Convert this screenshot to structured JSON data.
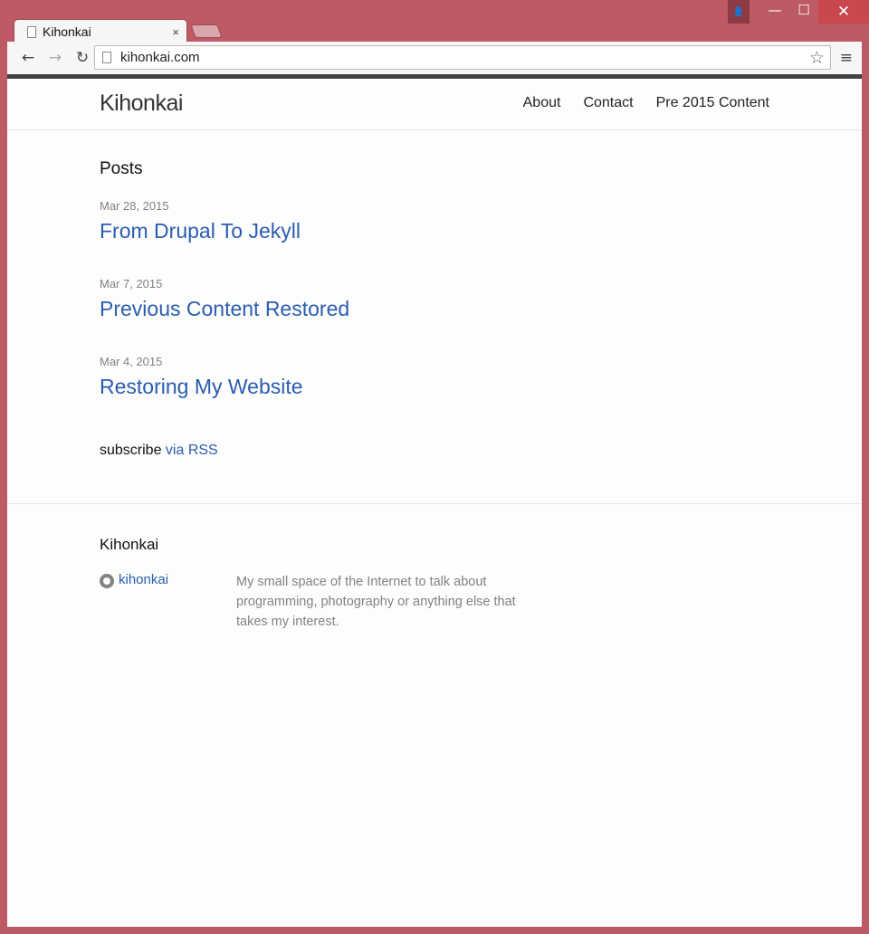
{
  "browser": {
    "tab_title": "Kihonkai",
    "tab_close": "×",
    "url": "kihonkai.com",
    "back": "←",
    "forward": "→",
    "reload": "↻",
    "star": "☆",
    "menu": "≡",
    "window": {
      "user": "👤",
      "minimize": "—",
      "maximize": "☐",
      "close": "✕"
    }
  },
  "site": {
    "title": "Kihonkai",
    "nav": [
      "About",
      "Contact",
      "Pre 2015 Content"
    ]
  },
  "posts": {
    "heading": "Posts",
    "items": [
      {
        "date": "Mar 28, 2015",
        "title": "From Drupal To Jekyll"
      },
      {
        "date": "Mar 7, 2015",
        "title": "Previous Content Restored"
      },
      {
        "date": "Mar 4, 2015",
        "title": "Restoring My Website"
      }
    ],
    "subscribe_text": "subscribe ",
    "subscribe_link": "via RSS"
  },
  "footer": {
    "title": "Kihonkai",
    "github_user": "kihonkai",
    "description": "My small space of the Internet to talk about programming, photography or anything else that takes my interest."
  }
}
